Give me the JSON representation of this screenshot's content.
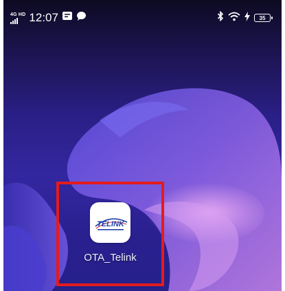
{
  "status_bar": {
    "network_type": "4G HD",
    "time": "12:07",
    "battery_level": "35",
    "icons": [
      "signal-icon",
      "notification-icon",
      "chat-bubble-icon",
      "bluetooth-icon",
      "wifi-icon",
      "charging-icon",
      "battery-icon"
    ]
  },
  "home": {
    "apps": [
      {
        "label": "OTA_Telink",
        "logo_text": "TELINK",
        "icon": "telink-logo-icon"
      }
    ]
  },
  "colors": {
    "highlight": "#e51b1b",
    "wallpaper_base": "#2a1f86",
    "wallpaper_highlight": "#b06bd6"
  }
}
